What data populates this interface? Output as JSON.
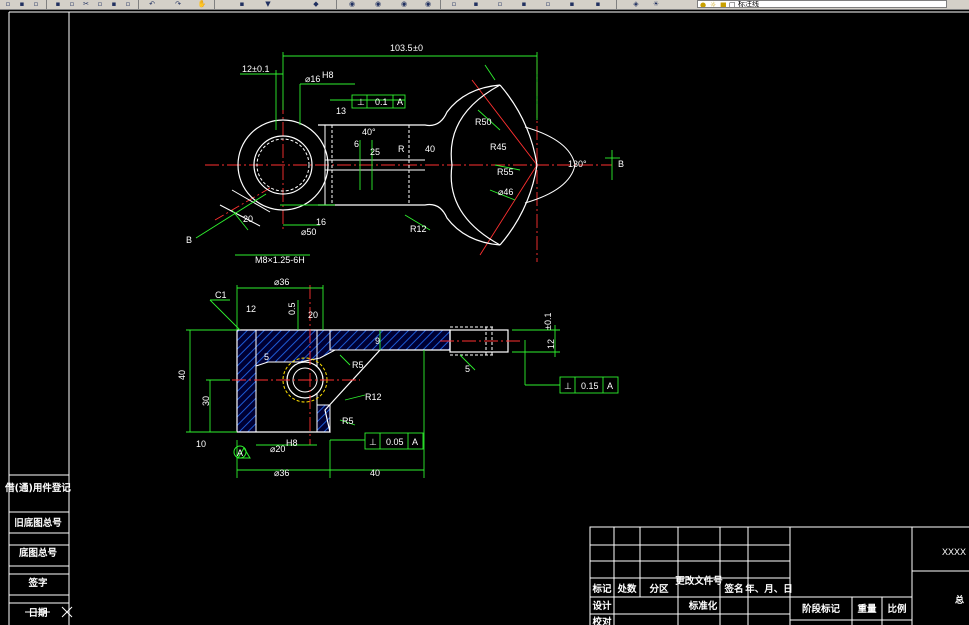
{
  "toolbar": {
    "layer_name": "标注线",
    "icons": [
      "new-icon",
      "open-icon",
      "save-icon",
      "print-icon",
      "preview-icon",
      "cut-icon",
      "copy-icon",
      "paste-icon",
      "match-icon",
      "undo-icon",
      "redo-icon",
      "pan-icon",
      "zoom-realtime-icon",
      "zoom-window-icon",
      "zoom-previous-icon",
      "properties-icon",
      "design-center-icon",
      "tool-palette-icon",
      "markup-icon",
      "calculator-icon",
      "help-icon",
      "layer-manager-icon",
      "layer-state-icon",
      "bulb-icon",
      "sun-icon",
      "lock-icon",
      "color-icon"
    ]
  },
  "drawing": {
    "top_view": {
      "dim_overall_length": "103.5",
      "dim_overall_tol": "±0",
      "dim_width_left": "12±0.1",
      "dim_bore": "⌀16",
      "dim_bore_tol": "H8",
      "dim_R": "R",
      "dim_angle_40": "40°",
      "dim_25": "25",
      "dim_6": "6",
      "dim_13": "13",
      "dim_16": "16",
      "dim_20": "20",
      "dim_50": "⌀50",
      "dim_40": "40",
      "dim_R12": "R12",
      "dim_R50": "R50",
      "dim_R45": "R45",
      "dim_R55": "R55",
      "dim_46": "⌀46",
      "dim_angle_130": "130°",
      "thread": "M8×1.25-6H",
      "gdt_perp_sym": "⊥",
      "gdt_perp_val": "0.1",
      "gdt_perp_datum": "A",
      "section_B_left": "B",
      "section_B_right": "B"
    },
    "front_view": {
      "dim_36_top": "⌀36",
      "dim_C1": "C1",
      "dim_12": "12",
      "dim_20": "20",
      "dim_05": "0.5",
      "dim_9": "9",
      "dim_5": "5",
      "dim_R5": "R5",
      "dim_R12": "R12",
      "dim_R5b": "R5",
      "dim_5b": "5",
      "dim_12_right": "12",
      "dim_12_right_tol": "±0.1",
      "dim_40_left": "40",
      "dim_30": "30",
      "dim_10": "10",
      "dim_bore_bottom": "⌀20",
      "dim_bore_bottom_tol": "H8",
      "dim_36_bottom": "⌀36",
      "dim_40_bottom": "40",
      "datum_A": "A",
      "gdt1_sym": "⊥",
      "gdt1_val": "0.15",
      "gdt1_datum": "A",
      "gdt2_sym": "⊥",
      "gdt2_val": "0.05",
      "gdt2_datum": "A"
    },
    "left_table": {
      "rows": [
        "借(通)用件登记",
        "旧底图总号",
        "底图总号",
        "签字",
        "日期"
      ]
    },
    "title_block": {
      "header_row": [
        "标记",
        "处数",
        "分区",
        "更改文件号",
        "签名",
        "年、月、日"
      ],
      "row_design": "设计",
      "row_standard": "标准化",
      "row_check": "校对",
      "stage_mark": "阶段标记",
      "weight": "重量",
      "scale": "比例",
      "company": "XXXX",
      "part_name": "总"
    }
  }
}
